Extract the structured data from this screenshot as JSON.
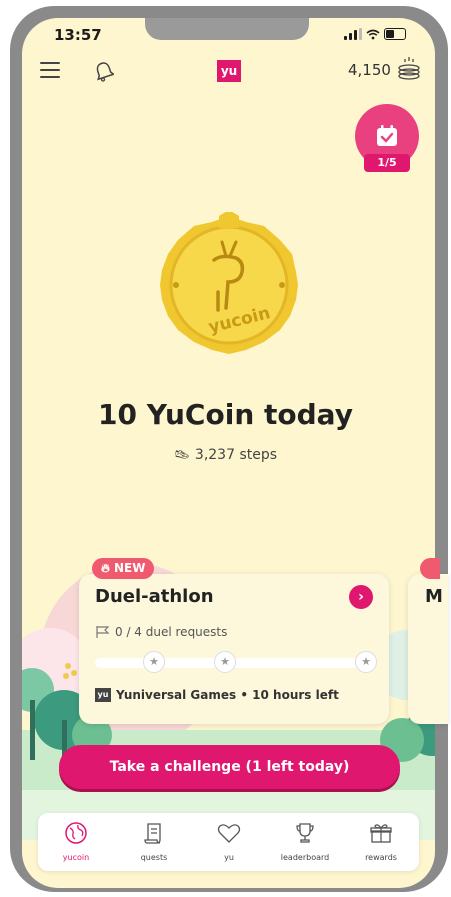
{
  "status": {
    "time": "13:57"
  },
  "header": {
    "logo": "yu",
    "balance": "4,150",
    "menu_icon": "hamburger-icon",
    "bell_icon": "bell-icon",
    "coins_icon": "coins-stack-icon"
  },
  "calendar": {
    "icon": "calendar-check-icon",
    "progress": "1/5"
  },
  "hero": {
    "coin_label": "yucoin",
    "headline": "10 YuCoin today",
    "steps": "3,237 steps"
  },
  "challenge_card": {
    "badge": "NEW",
    "title": "Duel-athlon",
    "requests": "0 / 4 duel requests",
    "requests_progress": 0,
    "organizer_logo": "yu",
    "organizer": "Yuniversal Games • 10 hours left",
    "next_card_title_initial": "M"
  },
  "cta": {
    "label": "Take a challenge (1 left today)"
  },
  "tabs": [
    {
      "label": "yucoin",
      "icon": "globe-icon",
      "active": true
    },
    {
      "label": "quests",
      "icon": "scroll-icon",
      "active": false
    },
    {
      "label": "yu",
      "icon": "heart-icon",
      "active": false
    },
    {
      "label": "leaderboard",
      "icon": "trophy-icon",
      "active": false
    },
    {
      "label": "rewards",
      "icon": "gift-box-icon",
      "active": false
    }
  ],
  "colors": {
    "brand": "#e0176f",
    "background": "#fdf6cf",
    "badge": "#ef5a6e",
    "coin": "#f2cf3d"
  }
}
